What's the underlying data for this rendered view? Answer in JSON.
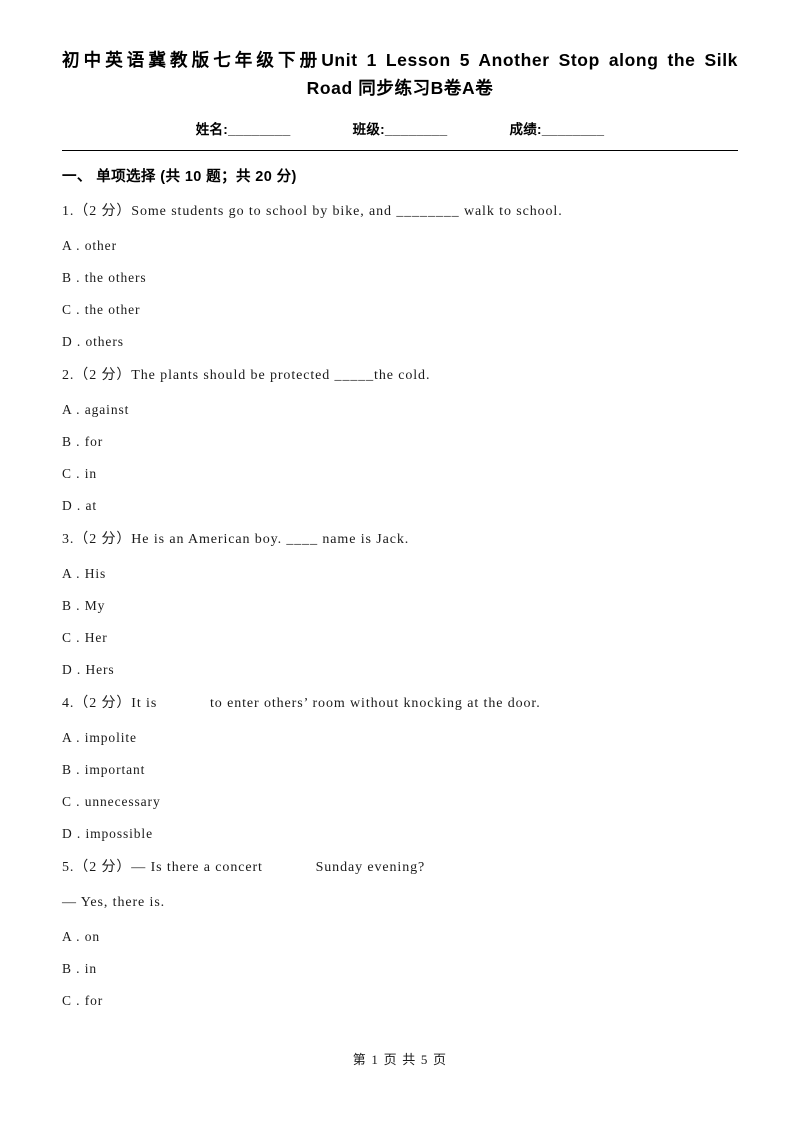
{
  "document": {
    "title_line_1": "初中英语冀教版七年级下册Unit 1 Lesson 5 Another Stop along the Silk",
    "title_line_2": "Road 同步练习B卷A卷",
    "fields": {
      "name": "姓名:________",
      "class": "班级:________",
      "score": "成绩:________"
    },
    "section_heading": "一、 单项选择 (共 10 题；共 20 分)",
    "questions": [
      {
        "stem": "1.（2 分）Some students go to school by bike, and ________ walk to school.",
        "options": [
          "A . other",
          "B . the others",
          "C . the other",
          "D . others"
        ]
      },
      {
        "stem": "2.（2 分）The plants should be protected _____the cold.",
        "options": [
          "A . against",
          "B . for",
          "C . in",
          "D . at"
        ]
      },
      {
        "stem": "3.（2 分）He is an American boy. ____ name is Jack.",
        "options": [
          "A . His",
          "B . My",
          "C . Her",
          "D . Hers"
        ]
      },
      {
        "stem": "4.（2 分）It is            to enter others’ room without knocking at the door.",
        "options": [
          "A . impolite",
          "B . important",
          "C . unnecessary",
          "D . impossible"
        ]
      },
      {
        "stem": "5.（2 分）— Is there a concert            Sunday evening?",
        "sub": "— Yes, there is.",
        "options": [
          "A . on",
          "B . in",
          "C . for"
        ]
      }
    ],
    "footer": "第 1 页 共 5 页"
  }
}
